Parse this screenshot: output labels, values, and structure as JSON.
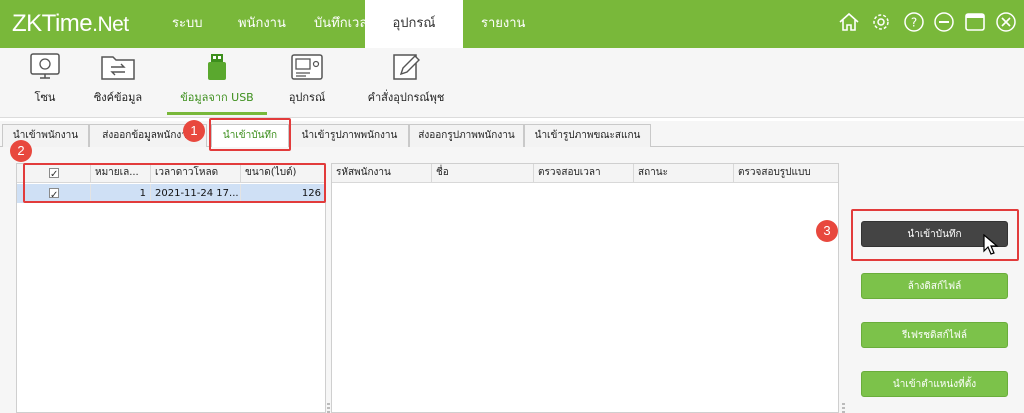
{
  "app": {
    "logo_main": "ZKTime",
    "logo_suffix": ".Net"
  },
  "nav": [
    "ระบบ",
    "พนักงาน",
    "บันทึกเวลา",
    "อุปกรณ์",
    "รายงาน"
  ],
  "nav_active": "อุปกรณ์",
  "window_controls": [
    "home-icon",
    "gear-icon",
    "help-icon",
    "minimize-icon",
    "maximize-icon",
    "close-icon"
  ],
  "toolbar": {
    "items": [
      {
        "label": "โซน",
        "icon": "monitor-icon"
      },
      {
        "label": "ซิงค์ข้อมูล",
        "icon": "folder-sync-icon"
      },
      {
        "label": "ข้อมูลจาก USB",
        "icon": "usb-drive-icon"
      },
      {
        "label": "อุปกรณ์",
        "icon": "device-icon"
      },
      {
        "label": "คำสั่งอุปกรณ์พุช",
        "icon": "edit-note-icon"
      }
    ],
    "active": "ข้อมูลจาก USB"
  },
  "subtabs": [
    "นำเข้าพนักงาน",
    "ส่งออกข้อมูลพนักงาน",
    "นำเข้าบันทึก",
    "นำเข้ารูปภาพพนักงาน",
    "ส่งออกรูปภาพพนักงาน",
    "นำเข้ารูปภาพขณะสแกน"
  ],
  "subtab_active": "นำเข้าบันทึก",
  "file_table": {
    "columns": [
      "",
      "หมายเล...",
      "เวลาดาวโหลด",
      "ขนาด(ไบต์)"
    ],
    "rows": [
      {
        "checked": true,
        "number": "1",
        "download_time": "2021-11-24 17...",
        "size": "126"
      }
    ]
  },
  "record_table": {
    "columns": [
      "รหัสพนักงาน",
      "ชื่อ",
      "ตรวจสอบเวลา",
      "สถานะ",
      "ตรวจสอบรูปแบบ"
    ]
  },
  "buttons": {
    "import_records": "นำเข้าบันทึก",
    "clear_disk_files": "ล้างดิสก์ไฟล์",
    "refresh_disk_files": "รีเฟรชดิสก์ไฟล์",
    "import_location": "นำเข้าตำแหน่งที่ตั้ง"
  },
  "annotations": {
    "step1": "1",
    "step2": "2",
    "step3": "3"
  },
  "colors": {
    "brand": "#79b83a",
    "button": "#7cc24a",
    "button_dark": "#444444",
    "annotation": "#e23b3b"
  }
}
